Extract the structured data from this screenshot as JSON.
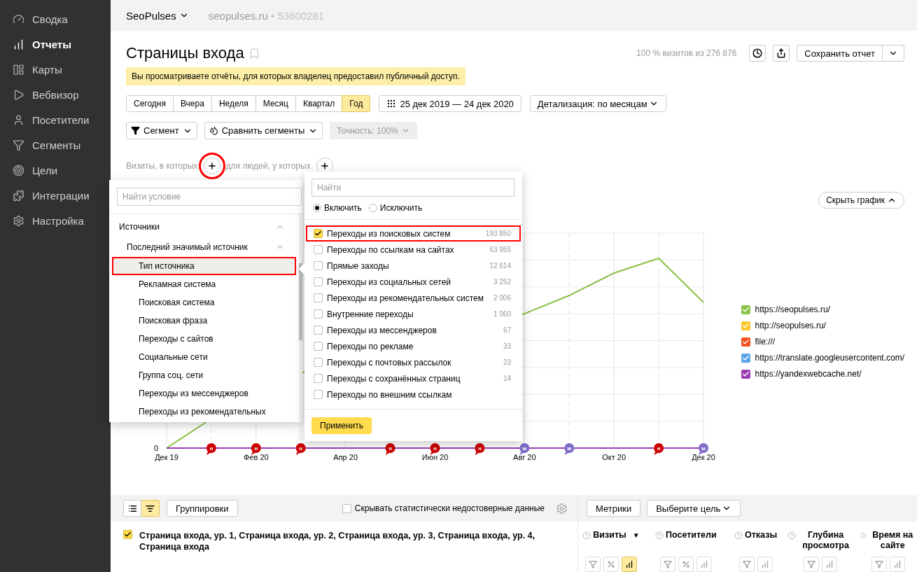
{
  "sidebar": {
    "items": [
      {
        "label": "Сводка",
        "selected": false
      },
      {
        "label": "Отчеты",
        "selected": true
      },
      {
        "label": "Карты",
        "selected": false
      },
      {
        "label": "Вебвизор",
        "selected": false
      },
      {
        "label": "Посетители",
        "selected": false
      },
      {
        "label": "Сегменты",
        "selected": false
      },
      {
        "label": "Цели",
        "selected": false
      },
      {
        "label": "Интеграции",
        "selected": false
      },
      {
        "label": "Настройка",
        "selected": false
      }
    ]
  },
  "topbar": {
    "account": "SeoPulses",
    "site": "seopulses.ru",
    "separator": "•",
    "counter_id": "53600281"
  },
  "report": {
    "title": "Страницы входа",
    "stats": "100 % визитов из 276 876",
    "save_button": "Сохранить отчет"
  },
  "notice": "Вы просматриваете отчёты, для которых владелец предоставил публичный доступ.",
  "periods": [
    {
      "label": "Сегодня",
      "selected": false
    },
    {
      "label": "Вчера",
      "selected": false
    },
    {
      "label": "Неделя",
      "selected": false
    },
    {
      "label": "Месяц",
      "selected": false
    },
    {
      "label": "Квартал",
      "selected": false
    },
    {
      "label": "Год",
      "selected": true
    }
  ],
  "date_range": "25 дек 2019 — 24 дек 2020",
  "detail": "Детализация: по месяцам",
  "segment_button": "Сегмент",
  "compare_button": "Сравнить сегменты",
  "accuracy": {
    "label": "Точность: 100%",
    "disabled": true
  },
  "conditions": {
    "visits_label": "Визиты, в которых",
    "visits_add_highlighted": true,
    "people_label": "для людей, у которых"
  },
  "hide_chart": "Скрыть график",
  "chart": {
    "y_label": "0",
    "x_labels": [
      "Дек 19",
      "Фев 20",
      "Апр 20",
      "Июн 20",
      "Авг 20",
      "Окт 20",
      "Дек 20"
    ],
    "markers": [
      {
        "letter": "н",
        "color": "#cc0000"
      },
      {
        "letter": "н",
        "color": "#cc0000"
      },
      {
        "letter": "н",
        "color": "#cc0000"
      },
      {
        "letter": "н",
        "color": "#cc0000"
      },
      {
        "letter": "н",
        "color": "#cc0000"
      },
      {
        "letter": "н",
        "color": "#cc0000"
      },
      {
        "letter": "м",
        "color": "#7e6cc9"
      },
      {
        "letter": "м",
        "color": "#7e6cc9"
      },
      {
        "letter": "н",
        "color": "#cc0000"
      },
      {
        "letter": "м",
        "color": "#7e6cc9"
      }
    ]
  },
  "legend": [
    {
      "label": "https://seopulses.ru/",
      "color": "#8bc34a",
      "checked": true
    },
    {
      "label": "http://seopulses.ru/",
      "color": "#f9c82b",
      "checked": true
    },
    {
      "label": "file:///",
      "color": "#f4511e",
      "checked": true
    },
    {
      "label": "https://translate.googleusercontent.com/",
      "color": "#5aa6e8",
      "checked": true
    },
    {
      "label": "https://yandexwebcache.net/",
      "color": "#9c3fb5",
      "checked": true
    }
  ],
  "condition_menu": {
    "placeholder": "Найти условие",
    "tree": [
      {
        "label": "Источники",
        "expanded": true,
        "children": [
          {
            "label": "Последний значимый источник",
            "expanded": true,
            "children": [
              {
                "label": "Тип источника",
                "selected": true,
                "highlighted": true
              },
              {
                "label": "Рекламная система",
                "selected": false,
                "highlighted": false
              },
              {
                "label": "Поисковая система",
                "selected": false,
                "highlighted": false
              },
              {
                "label": "Поисковая фраза",
                "selected": false,
                "highlighted": false
              },
              {
                "label": "Переходы с сайтов",
                "selected": false,
                "highlighted": false
              },
              {
                "label": "Социальные сети",
                "selected": false,
                "highlighted": false
              },
              {
                "label": "Группа соц. сети",
                "selected": false,
                "highlighted": false
              },
              {
                "label": "Переходы из мессенджеров",
                "selected": false,
                "highlighted": false
              },
              {
                "label": "Переходы из рекомендательных",
                "selected": false,
                "highlighted": false
              }
            ]
          }
        ]
      }
    ]
  },
  "filter_menu": {
    "placeholder": "Найти",
    "modes": [
      {
        "label": "Включить",
        "selected": true
      },
      {
        "label": "Исключить",
        "selected": false
      }
    ],
    "options": [
      {
        "label": "Переходы из поисковых систем",
        "count": "193 850",
        "checked": true,
        "highlighted": true
      },
      {
        "label": "Переходы по ссылкам на сайтах",
        "count": "63 955",
        "checked": false,
        "highlighted": false
      },
      {
        "label": "Прямые заходы",
        "count": "12 614",
        "checked": false,
        "highlighted": false
      },
      {
        "label": "Переходы из социальных сетей",
        "count": "3 252",
        "checked": false,
        "highlighted": false
      },
      {
        "label": "Переходы из рекомендательных систем",
        "count": "2 006",
        "checked": false,
        "highlighted": false
      },
      {
        "label": "Внутренние переходы",
        "count": "1 060",
        "checked": false,
        "highlighted": false
      },
      {
        "label": "Переходы из мессенджеров",
        "count": "67",
        "checked": false,
        "highlighted": false
      },
      {
        "label": "Переходы по рекламе",
        "count": "33",
        "checked": false,
        "highlighted": false
      },
      {
        "label": "Переходы с почтовых рассылок",
        "count": "23",
        "checked": false,
        "highlighted": false
      },
      {
        "label": "Переходы с сохранённых страниц",
        "count": "14",
        "checked": false,
        "highlighted": false
      },
      {
        "label": "Переходы по внешним ссылкам",
        "checked": false,
        "highlighted": false
      }
    ],
    "apply": "Применить"
  },
  "table_toolbar": {
    "views": [
      {
        "kind": "list",
        "selected": false
      },
      {
        "kind": "tree",
        "selected": true
      }
    ],
    "groupings": "Группировки",
    "hide_unreliable": {
      "label": "Скрывать статистически недостоверные данные",
      "checked": false
    },
    "metrics_button": "Метрики",
    "goal_select": "Выберите цель"
  },
  "table": {
    "dimensions": {
      "label": "Страница входа, ур. 1, Страница входа, ур. 2, Страница входа, ур. 3, Страница входа, ур. 4, Страница входа",
      "checked": true
    },
    "metrics": [
      {
        "label": "Визиты",
        "sort_mark": "▼",
        "buttons": [
          {
            "kind": "filter",
            "selected": false
          },
          {
            "kind": "percent",
            "selected": false
          },
          {
            "kind": "bars",
            "selected": true
          }
        ]
      },
      {
        "label": "Посетители",
        "buttons": [
          {
            "kind": "filter",
            "selected": false
          },
          {
            "kind": "percent",
            "selected": false
          },
          {
            "kind": "bars",
            "selected": false
          }
        ]
      },
      {
        "label": "Отказы",
        "buttons": [
          {
            "kind": "filter",
            "selected": false
          },
          {
            "kind": "bars",
            "selected": false
          }
        ]
      },
      {
        "label": "Глубина просмотра",
        "buttons": [
          {
            "kind": "filter",
            "selected": false
          },
          {
            "kind": "bars",
            "selected": false
          }
        ]
      },
      {
        "label": "Время на сайте",
        "buttons": [
          {
            "kind": "filter",
            "selected": false
          },
          {
            "kind": "bars",
            "selected": false
          }
        ]
      }
    ]
  }
}
